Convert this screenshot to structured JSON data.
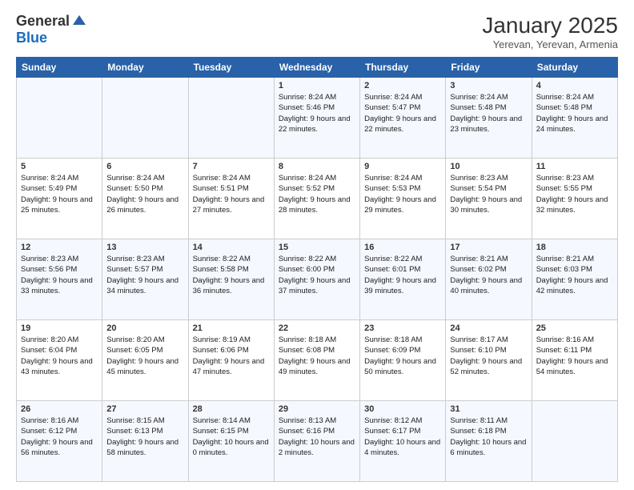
{
  "header": {
    "logo_general": "General",
    "logo_blue": "Blue",
    "month_title": "January 2025",
    "location": "Yerevan, Yerevan, Armenia"
  },
  "days_of_week": [
    "Sunday",
    "Monday",
    "Tuesday",
    "Wednesday",
    "Thursday",
    "Friday",
    "Saturday"
  ],
  "weeks": [
    [
      {
        "day": "",
        "sunrise": "",
        "sunset": "",
        "daylight": ""
      },
      {
        "day": "",
        "sunrise": "",
        "sunset": "",
        "daylight": ""
      },
      {
        "day": "",
        "sunrise": "",
        "sunset": "",
        "daylight": ""
      },
      {
        "day": "1",
        "sunrise": "Sunrise: 8:24 AM",
        "sunset": "Sunset: 5:46 PM",
        "daylight": "Daylight: 9 hours and 22 minutes."
      },
      {
        "day": "2",
        "sunrise": "Sunrise: 8:24 AM",
        "sunset": "Sunset: 5:47 PM",
        "daylight": "Daylight: 9 hours and 22 minutes."
      },
      {
        "day": "3",
        "sunrise": "Sunrise: 8:24 AM",
        "sunset": "Sunset: 5:48 PM",
        "daylight": "Daylight: 9 hours and 23 minutes."
      },
      {
        "day": "4",
        "sunrise": "Sunrise: 8:24 AM",
        "sunset": "Sunset: 5:48 PM",
        "daylight": "Daylight: 9 hours and 24 minutes."
      }
    ],
    [
      {
        "day": "5",
        "sunrise": "Sunrise: 8:24 AM",
        "sunset": "Sunset: 5:49 PM",
        "daylight": "Daylight: 9 hours and 25 minutes."
      },
      {
        "day": "6",
        "sunrise": "Sunrise: 8:24 AM",
        "sunset": "Sunset: 5:50 PM",
        "daylight": "Daylight: 9 hours and 26 minutes."
      },
      {
        "day": "7",
        "sunrise": "Sunrise: 8:24 AM",
        "sunset": "Sunset: 5:51 PM",
        "daylight": "Daylight: 9 hours and 27 minutes."
      },
      {
        "day": "8",
        "sunrise": "Sunrise: 8:24 AM",
        "sunset": "Sunset: 5:52 PM",
        "daylight": "Daylight: 9 hours and 28 minutes."
      },
      {
        "day": "9",
        "sunrise": "Sunrise: 8:24 AM",
        "sunset": "Sunset: 5:53 PM",
        "daylight": "Daylight: 9 hours and 29 minutes."
      },
      {
        "day": "10",
        "sunrise": "Sunrise: 8:23 AM",
        "sunset": "Sunset: 5:54 PM",
        "daylight": "Daylight: 9 hours and 30 minutes."
      },
      {
        "day": "11",
        "sunrise": "Sunrise: 8:23 AM",
        "sunset": "Sunset: 5:55 PM",
        "daylight": "Daylight: 9 hours and 32 minutes."
      }
    ],
    [
      {
        "day": "12",
        "sunrise": "Sunrise: 8:23 AM",
        "sunset": "Sunset: 5:56 PM",
        "daylight": "Daylight: 9 hours and 33 minutes."
      },
      {
        "day": "13",
        "sunrise": "Sunrise: 8:23 AM",
        "sunset": "Sunset: 5:57 PM",
        "daylight": "Daylight: 9 hours and 34 minutes."
      },
      {
        "day": "14",
        "sunrise": "Sunrise: 8:22 AM",
        "sunset": "Sunset: 5:58 PM",
        "daylight": "Daylight: 9 hours and 36 minutes."
      },
      {
        "day": "15",
        "sunrise": "Sunrise: 8:22 AM",
        "sunset": "Sunset: 6:00 PM",
        "daylight": "Daylight: 9 hours and 37 minutes."
      },
      {
        "day": "16",
        "sunrise": "Sunrise: 8:22 AM",
        "sunset": "Sunset: 6:01 PM",
        "daylight": "Daylight: 9 hours and 39 minutes."
      },
      {
        "day": "17",
        "sunrise": "Sunrise: 8:21 AM",
        "sunset": "Sunset: 6:02 PM",
        "daylight": "Daylight: 9 hours and 40 minutes."
      },
      {
        "day": "18",
        "sunrise": "Sunrise: 8:21 AM",
        "sunset": "Sunset: 6:03 PM",
        "daylight": "Daylight: 9 hours and 42 minutes."
      }
    ],
    [
      {
        "day": "19",
        "sunrise": "Sunrise: 8:20 AM",
        "sunset": "Sunset: 6:04 PM",
        "daylight": "Daylight: 9 hours and 43 minutes."
      },
      {
        "day": "20",
        "sunrise": "Sunrise: 8:20 AM",
        "sunset": "Sunset: 6:05 PM",
        "daylight": "Daylight: 9 hours and 45 minutes."
      },
      {
        "day": "21",
        "sunrise": "Sunrise: 8:19 AM",
        "sunset": "Sunset: 6:06 PM",
        "daylight": "Daylight: 9 hours and 47 minutes."
      },
      {
        "day": "22",
        "sunrise": "Sunrise: 8:18 AM",
        "sunset": "Sunset: 6:08 PM",
        "daylight": "Daylight: 9 hours and 49 minutes."
      },
      {
        "day": "23",
        "sunrise": "Sunrise: 8:18 AM",
        "sunset": "Sunset: 6:09 PM",
        "daylight": "Daylight: 9 hours and 50 minutes."
      },
      {
        "day": "24",
        "sunrise": "Sunrise: 8:17 AM",
        "sunset": "Sunset: 6:10 PM",
        "daylight": "Daylight: 9 hours and 52 minutes."
      },
      {
        "day": "25",
        "sunrise": "Sunrise: 8:16 AM",
        "sunset": "Sunset: 6:11 PM",
        "daylight": "Daylight: 9 hours and 54 minutes."
      }
    ],
    [
      {
        "day": "26",
        "sunrise": "Sunrise: 8:16 AM",
        "sunset": "Sunset: 6:12 PM",
        "daylight": "Daylight: 9 hours and 56 minutes."
      },
      {
        "day": "27",
        "sunrise": "Sunrise: 8:15 AM",
        "sunset": "Sunset: 6:13 PM",
        "daylight": "Daylight: 9 hours and 58 minutes."
      },
      {
        "day": "28",
        "sunrise": "Sunrise: 8:14 AM",
        "sunset": "Sunset: 6:15 PM",
        "daylight": "Daylight: 10 hours and 0 minutes."
      },
      {
        "day": "29",
        "sunrise": "Sunrise: 8:13 AM",
        "sunset": "Sunset: 6:16 PM",
        "daylight": "Daylight: 10 hours and 2 minutes."
      },
      {
        "day": "30",
        "sunrise": "Sunrise: 8:12 AM",
        "sunset": "Sunset: 6:17 PM",
        "daylight": "Daylight: 10 hours and 4 minutes."
      },
      {
        "day": "31",
        "sunrise": "Sunrise: 8:11 AM",
        "sunset": "Sunset: 6:18 PM",
        "daylight": "Daylight: 10 hours and 6 minutes."
      },
      {
        "day": "",
        "sunrise": "",
        "sunset": "",
        "daylight": ""
      }
    ]
  ]
}
